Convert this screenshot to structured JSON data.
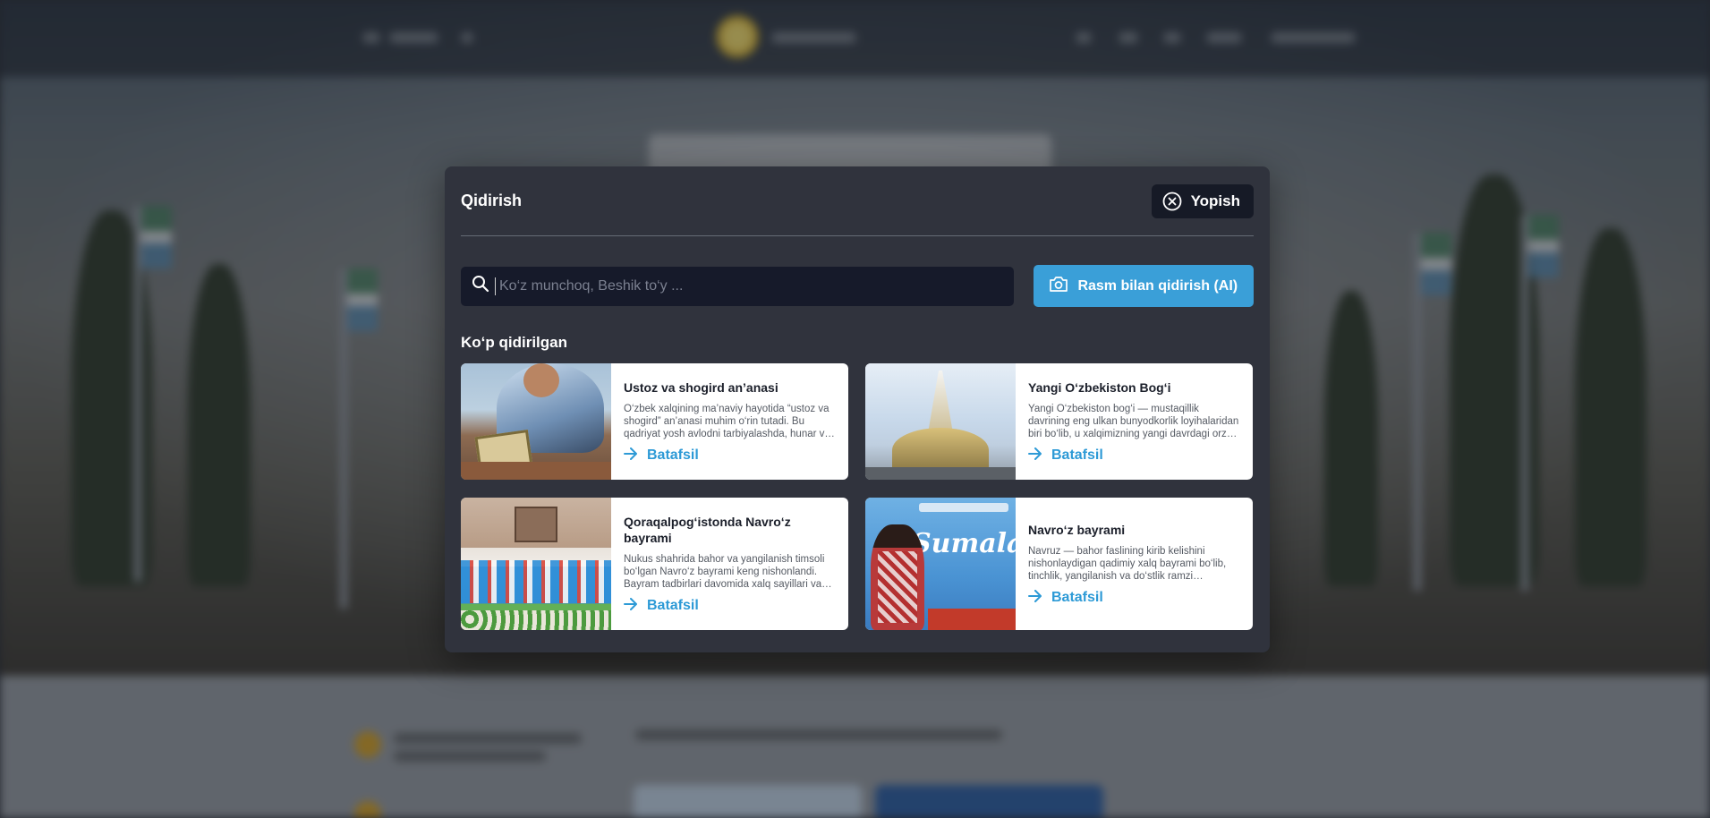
{
  "modal": {
    "title": "Qidirish",
    "close_label": "Yopish",
    "search_placeholder": "Ko‘z munchoq, Beshik to‘y ...",
    "search_value": "",
    "ai_button_label": "Rasm bilan qidirish (AI)",
    "section_title": "Ko‘p qidirilgan",
    "link_label": "Batafsil",
    "cards": [
      {
        "title": "Ustoz va shogird an’anasi",
        "description": "O‘zbek xalqining ma’naviy hayotida “ustoz va shogird” an’anasi muhim o‘rin tutadi. Bu qadriyat yosh avlodni tarbiyalashda, hunar va ilmni avloddan-avlodga yetkazishda beqiyos ahamiyatga ega."
      },
      {
        "title": "Yangi O‘zbekiston Bog‘i",
        "description": "Yangi O‘zbekiston bog‘i — mustaqillik davrining eng ulkan bunyodkorlik loyihalaridan biri bo‘lib, u xalqimizning yangi davrdagi orzu-umidlarini ifodalaydi."
      },
      {
        "title": "Qoraqalpog‘istonda Navro‘z bayrami",
        "description": "Nukus shahrida bahor va yangilanish timsoli bo‘lgan Navro‘z bayrami keng nishonlandi. Bayram tadbirlari davomida xalq sayillari va konsert dasturlari bo‘lib o‘tdi."
      },
      {
        "title": "Navro‘z bayrami",
        "description": "Navruz — bahor faslining kirib kelishini nishonlaydigan qadimiy xalq bayrami bo‘lib, tinchlik, yangilanish va do‘stlik ramzi hisoblanadi."
      }
    ]
  },
  "thumbnails": {
    "card4_banner_text": "Sumalak"
  },
  "colors": {
    "accent": "#3a9fd8",
    "link": "#2d9ad6",
    "modal_bg": "#30333d",
    "input_bg": "#161a2a"
  },
  "icons": {
    "close": "close-circle-icon",
    "search": "search-icon",
    "camera": "camera-icon",
    "arrow": "arrow-right-icon"
  }
}
